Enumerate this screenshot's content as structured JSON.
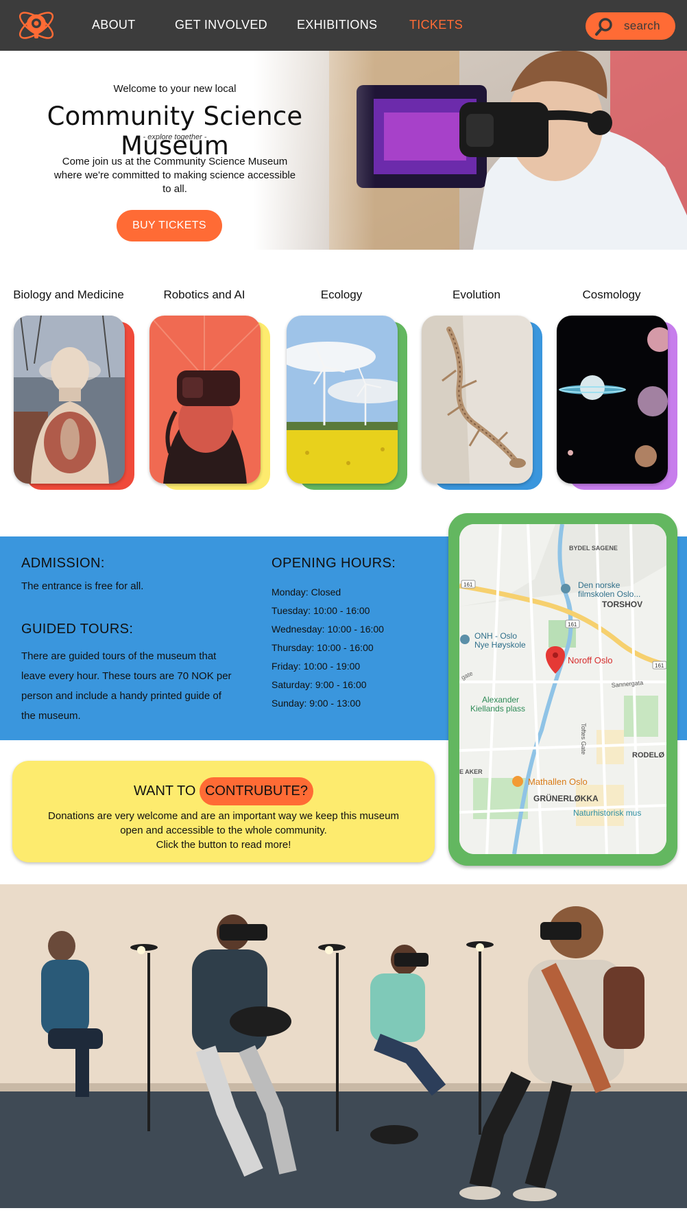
{
  "nav": {
    "links": [
      {
        "label": "ABOUT"
      },
      {
        "label": "GET INVOLVED"
      },
      {
        "label": "EXHIBITIONS"
      },
      {
        "label": "TICKETS",
        "active": true
      }
    ],
    "search_label": "search",
    "accent": "#ff6b35",
    "background": "#3c3c3c"
  },
  "hero": {
    "welcome": "Welcome to your new local",
    "title": "Community Science Museum",
    "tagline": "- explore together -",
    "description": "Come join us at the Community Science Museum where we're committed to making science accessible to all.",
    "button": "BUY TICKETS"
  },
  "categories": [
    {
      "label": "Biology and Medicine",
      "accent": "#f04a3a",
      "image": "anatomy-model"
    },
    {
      "label": "Robotics and AI",
      "accent": "#fdeb6e",
      "image": "vr-headset"
    },
    {
      "label": "Ecology",
      "accent": "#63b760",
      "image": "wind-turbines"
    },
    {
      "label": "Evolution",
      "accent": "#3a96dd",
      "image": "fossil"
    },
    {
      "label": "Cosmology",
      "accent": "#c77dec",
      "image": "planets"
    }
  ],
  "info": {
    "admission_heading": "ADMISSION:",
    "admission_text": "The entrance is free for all.",
    "tours_heading": "GUIDED TOURS:",
    "tours_text": "There are guided tours of the museum that leave every hour. These tours are 70 NOK per person and include a handy printed guide of the museum.",
    "hours_heading": "OPENING HOURS:",
    "hours": [
      "Monday: Closed",
      "Tuesday: 10:00 - 16:00",
      "Wednesday: 10:00 - 16:00",
      "Thursday: 10:00 - 16:00",
      "Friday: 10:00 - 19:00",
      "Saturday: 9:00 - 16:00",
      "Sunday: 9:00 - 13:00"
    ],
    "band_color": "#3a96dd"
  },
  "map": {
    "labels": {
      "bydel": "BYDEL SAGENE",
      "filmskolen1": "Den norske",
      "filmskolen2": "filmskolen Oslo...",
      "torshov": "TORSHOV",
      "onh1": "ONH - Oslo",
      "onh2": "Nye Høyskole",
      "noroff": "Noroff Oslo",
      "alexander1": "Alexander",
      "alexander2": "Kiellands plass",
      "sannergata": "Sannergata",
      "toftes": "Toftes Gate",
      "rodelok": "RODELØ",
      "aker": "E AKER",
      "mathallen": "Mathallen Oslo",
      "grunerlokka": "GRÜNERLØKKA",
      "naturhistorisk": "Naturhistorisk mus",
      "gate": "gate",
      "road161a": "161",
      "road161b": "161",
      "road161c": "161"
    }
  },
  "donate": {
    "title_prefix": "WANT TO ",
    "button": "CONTRUBUTE?",
    "line1": "Donations are very welcome and are an important way we keep this museum open and accessible to the whole community.",
    "line2": "Click the button to read more!",
    "background": "#fdeb6e"
  }
}
